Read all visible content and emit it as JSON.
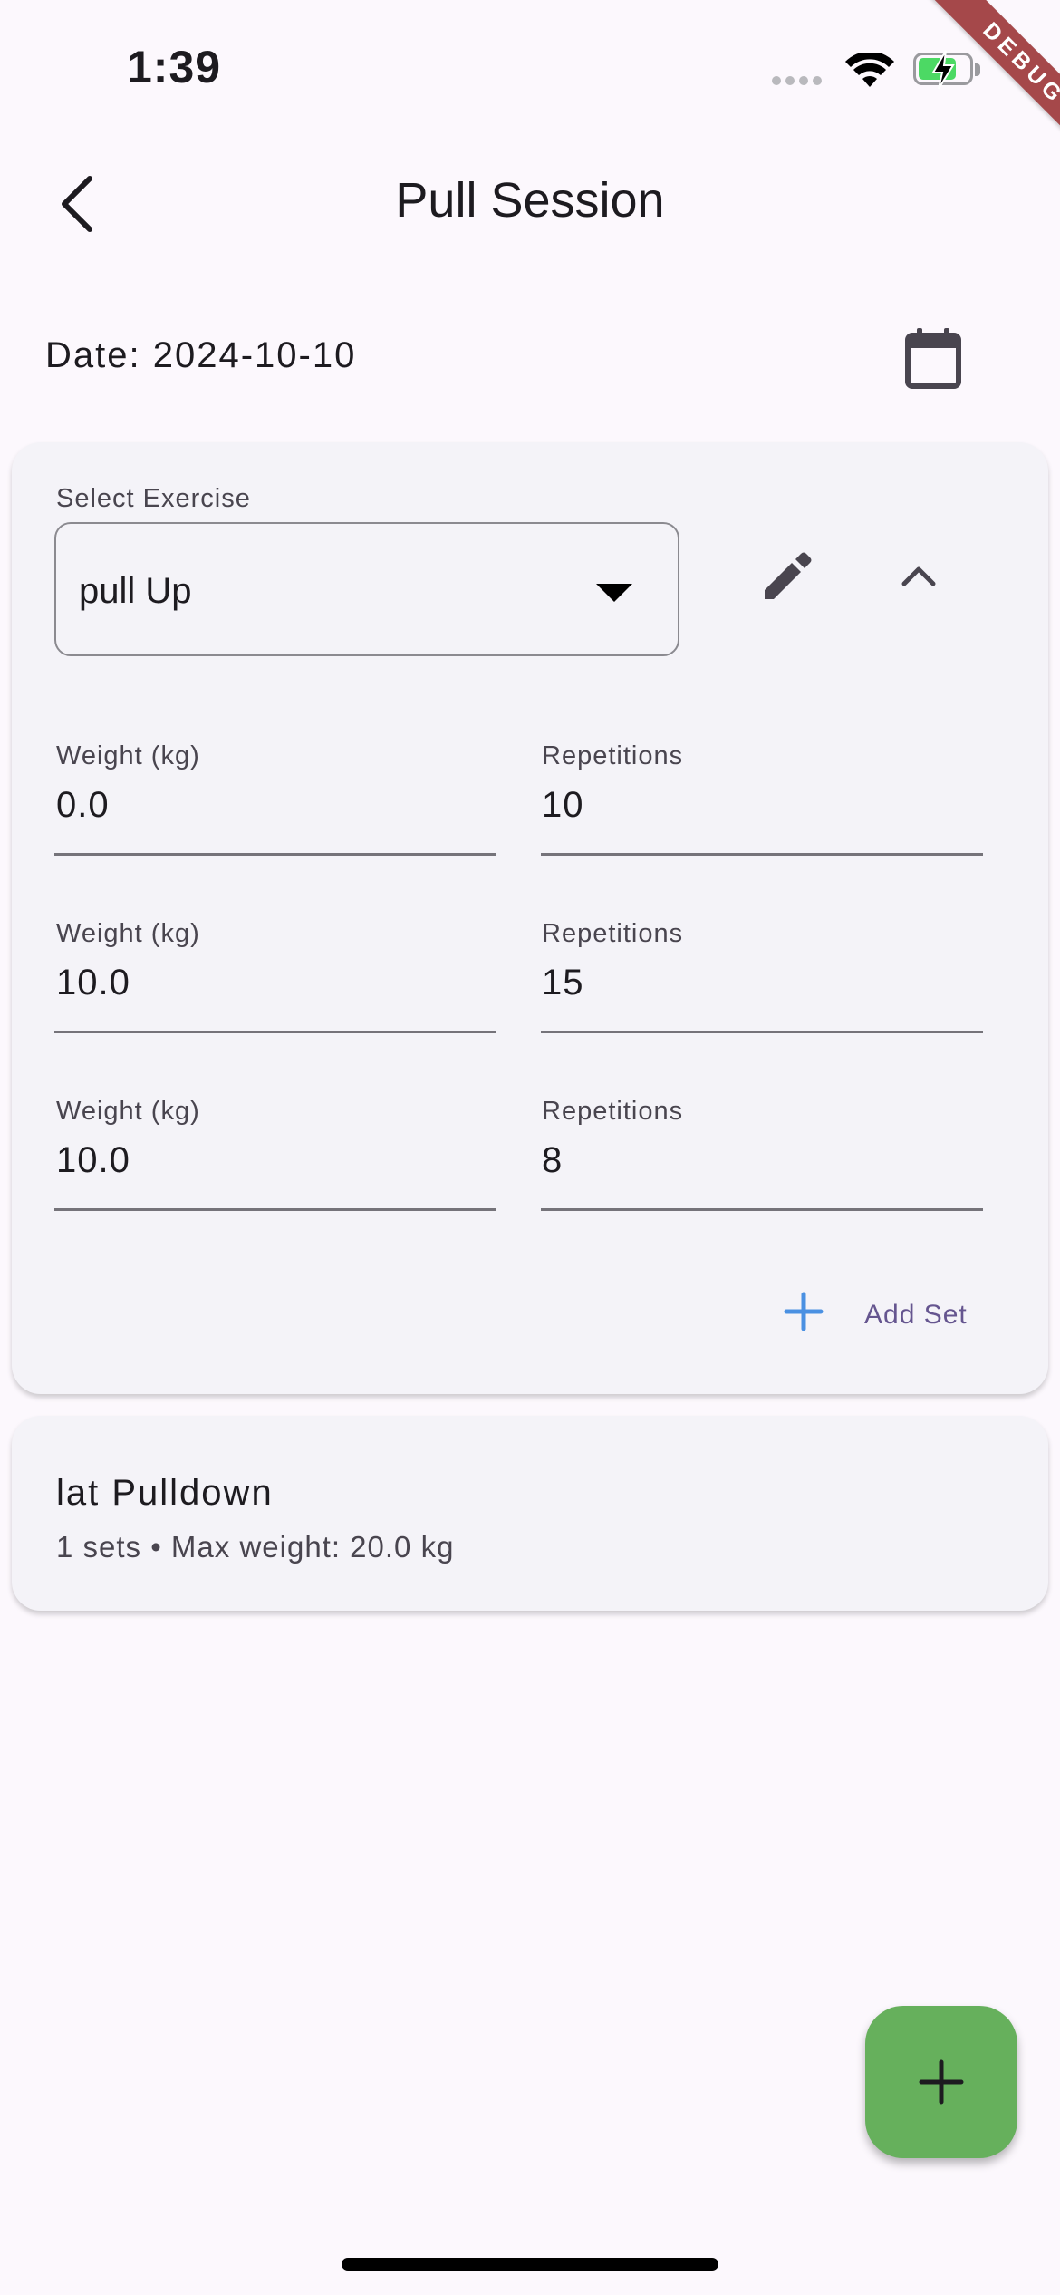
{
  "status_bar": {
    "time": "1:39",
    "battery_level": 0.75
  },
  "debug_banner": "DEBUG",
  "app_bar": {
    "title": "Pull Session"
  },
  "date": {
    "label": "Date: 2024-10-10"
  },
  "exercise_card": {
    "select_label": "Select Exercise",
    "selected_exercise": "pull Up",
    "sets": [
      {
        "weight_label": "Weight (kg)",
        "weight": "0.0",
        "reps_label": "Repetitions",
        "reps": "10"
      },
      {
        "weight_label": "Weight (kg)",
        "weight": "10.0",
        "reps_label": "Repetitions",
        "reps": "15"
      },
      {
        "weight_label": "Weight (kg)",
        "weight": "10.0",
        "reps_label": "Repetitions",
        "reps": "8"
      }
    ],
    "add_set_label": "Add Set"
  },
  "summary_card": {
    "title": "lat Pulldown",
    "subtitle": "1 sets • Max weight: 20.0 kg"
  },
  "colors": {
    "background": "#fcf8fd",
    "card": "#f4f3f8",
    "fab": "#66b05c",
    "accent_blue": "#4a90e2",
    "accent_purple": "#65558f",
    "debug_ribbon": "#a5484a"
  }
}
